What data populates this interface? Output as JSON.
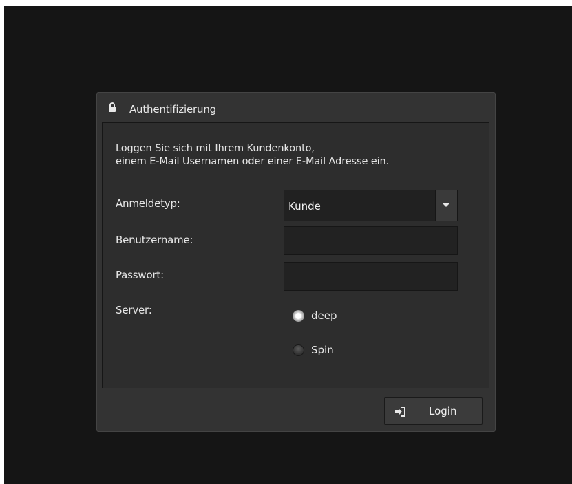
{
  "dialog": {
    "title": "Authentifizierung",
    "title_icon": "lock-icon",
    "intro_line1": "Loggen Sie sich mit Ihrem Kundenkonto,",
    "intro_line2": "einem E-Mail Usernamen oder einer E-Mail Adresse ein."
  },
  "form": {
    "login_type_label": "Anmeldetyp:",
    "login_type_value": "Kunde",
    "username_label": "Benutzername:",
    "username_value": "",
    "password_label": "Passwort:",
    "password_value": "",
    "server_label": "Server:",
    "servers": [
      {
        "label": "deep",
        "selected": true
      },
      {
        "label": "Spin",
        "selected": false
      }
    ]
  },
  "footer": {
    "login_label": "Login",
    "login_icon": "sign-in-icon"
  },
  "colors": {
    "background": "#151515",
    "dialog": "#333333",
    "panel": "#2d2d2d",
    "text": "#e6e6e6"
  }
}
